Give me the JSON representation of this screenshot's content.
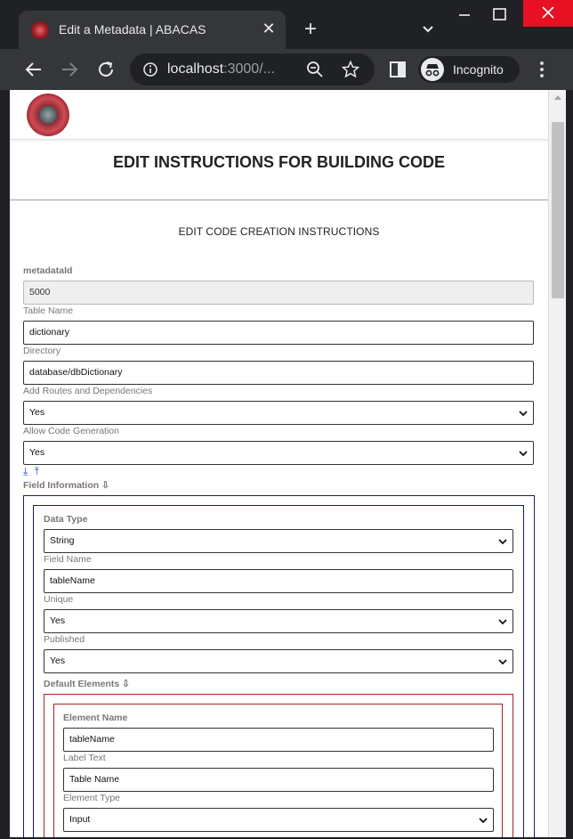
{
  "browser": {
    "tab_title": "Edit a Metadata | ABACAS",
    "tab_close": "✕",
    "new_tab": "+",
    "url_host": "localhost",
    "url_rest": ":3000/...",
    "incognito_label": "Incognito",
    "window_buttons": [
      "minimize",
      "maximize",
      "close"
    ]
  },
  "page": {
    "title": "EDIT INSTRUCTIONS FOR BUILDING CODE",
    "section_title": "EDIT CODE CREATION INSTRUCTIONS",
    "form": {
      "metadataid_label": "metadataId",
      "metadataid_value": "5000",
      "table_name_label": "Table Name",
      "table_name_value": "dictionary",
      "directory_label": "Directory",
      "directory_value": "database/dbDictionary",
      "routes_label": "Add Routes and Dependencies",
      "routes_value": "Yes",
      "codegen_label": "Allow Code Generation",
      "codegen_value": "Yes",
      "order_arrows": "⤓ ⤒",
      "field_info_label": "Field Information ⇩"
    },
    "field": {
      "data_type_label": "Data Type",
      "data_type_value": "String",
      "field_name_label": "Field Name",
      "field_name_value": "tableName",
      "unique_label": "Unique",
      "unique_value": "Yes",
      "published_label": "Published",
      "published_value": "Yes",
      "default_elements_label": "Default Elements ⇩"
    },
    "element": {
      "element_name_label": "Element Name",
      "element_name_value": "tableName",
      "label_text_label": "Label Text",
      "label_text_value": "Table Name",
      "element_type_label": "Element Type",
      "element_type_value": "Input"
    }
  },
  "colors": {
    "chrome_dark": "#202124",
    "chrome_toolbar": "#35363a",
    "close_red": "#e81123",
    "field_box_border": "#1a1a7a",
    "element_box_border": "#b02020",
    "order_arrow_blue": "#1a4bd1"
  }
}
